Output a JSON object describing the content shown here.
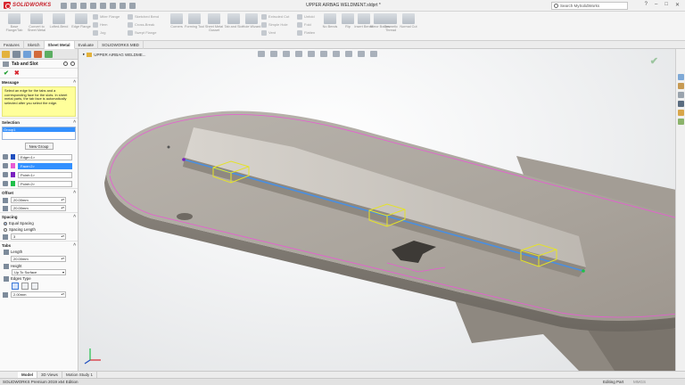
{
  "app": {
    "logo_text": "SOLIDWORKS",
    "document_title": "UPPER AIRBAG WELDMENT.sldprt *",
    "search_placeholder": "Search MySolidWorks",
    "accent_color": "#d8262f"
  },
  "ribbon": {
    "buttons": [
      {
        "label": "Base Flange/Tab",
        "icon": "base-flange-icon"
      },
      {
        "label": "Convert to Sheet Metal",
        "icon": "convert-sheet-metal-icon"
      },
      {
        "label": "Lofted-Bend",
        "icon": "lofted-bend-icon"
      },
      {
        "label": "Edge Flange",
        "icon": "edge-flange-icon"
      }
    ],
    "stack1": [
      "Miter Flange",
      "Hem",
      "Jog"
    ],
    "stack2": [
      "Sketched Bend",
      "Cross-Break",
      "Swept Flange"
    ],
    "buttons2": [
      {
        "label": "Corners",
        "icon": "corners-icon"
      },
      {
        "label": "Forming Tool",
        "icon": "forming-tool-icon"
      },
      {
        "label": "Sheet Metal Gusset",
        "icon": "gusset-icon"
      },
      {
        "label": "Tab and Slot",
        "icon": "tab-slot-icon"
      },
      {
        "label": "Unfold",
        "icon": "unfold-icon"
      }
    ],
    "buttons3": [
      {
        "label": "Hole Wizard",
        "icon": "hole-wizard-icon"
      }
    ],
    "stack3": [
      "Extruded Cut",
      "Simple Hole",
      "Vent"
    ],
    "stack4": [
      "Unfold",
      "Fold",
      "Flatten"
    ],
    "buttons4": [
      {
        "label": "No Bends",
        "icon": "no-bends-icon"
      },
      {
        "label": "Rip",
        "icon": "rip-icon"
      },
      {
        "label": "Insert Bends",
        "icon": "insert-bends-icon"
      },
      {
        "label": "Mirror Bodies",
        "icon": "mirror-icon"
      },
      {
        "label": "Cosmetic Thread",
        "icon": "thread-icon"
      },
      {
        "label": "Normal Cut",
        "icon": "normal-cut-icon"
      }
    ]
  },
  "command_tabs": [
    "Features",
    "Sketch",
    "Sheet Metal",
    "Evaluate",
    "SOLIDWORKS MBD"
  ],
  "active_command_tab": "Sheet Metal",
  "property_manager": {
    "title": "Tab and Slot",
    "message_header": "Message",
    "message": "Select an edge for the tabs and a corresponding face for the slots. In sheet metal parts, the tab face is automatically selected after you select the edge.",
    "selection_header": "Selection",
    "group_item": "Group1",
    "new_group_button": "New Group",
    "fields": [
      {
        "label": "Edge<1>",
        "color": "#1f4fbf",
        "selected": false
      },
      {
        "label": "Face<2>",
        "color": "#e85bd3",
        "selected": true
      },
      {
        "label": "Point<1>",
        "color": "#7a1fbf",
        "selected": false
      },
      {
        "label": "Point<2>",
        "color": "#1fbf4a",
        "selected": false
      }
    ],
    "offset_header": "Offset",
    "offset_values": [
      "20.00mm",
      "20.00mm"
    ],
    "spacing_header": "Spacing",
    "spacing_options": [
      "Equal Spacing",
      "Spacing Length"
    ],
    "spacing_selected": "Equal Spacing",
    "spacing_count": "3",
    "tabs_header": "Tabs",
    "length_label": "Length",
    "length_value": "20.00mm",
    "height_label": "Height",
    "height_mode": "Up To Surface",
    "edges_type_label": "Edges Type",
    "edges_value": "2.00mm"
  },
  "viewport": {
    "tree_label": "UPPER AIRBAG WELDME..."
  },
  "bottom_tabs": [
    "Model",
    "3D Views",
    "Motion Study 1"
  ],
  "active_bottom_tab": "Model",
  "status": {
    "left": "SOLIDWORKS Premium 2019 x64 Edition",
    "mode": "Editing Part",
    "units": "MMGS"
  }
}
